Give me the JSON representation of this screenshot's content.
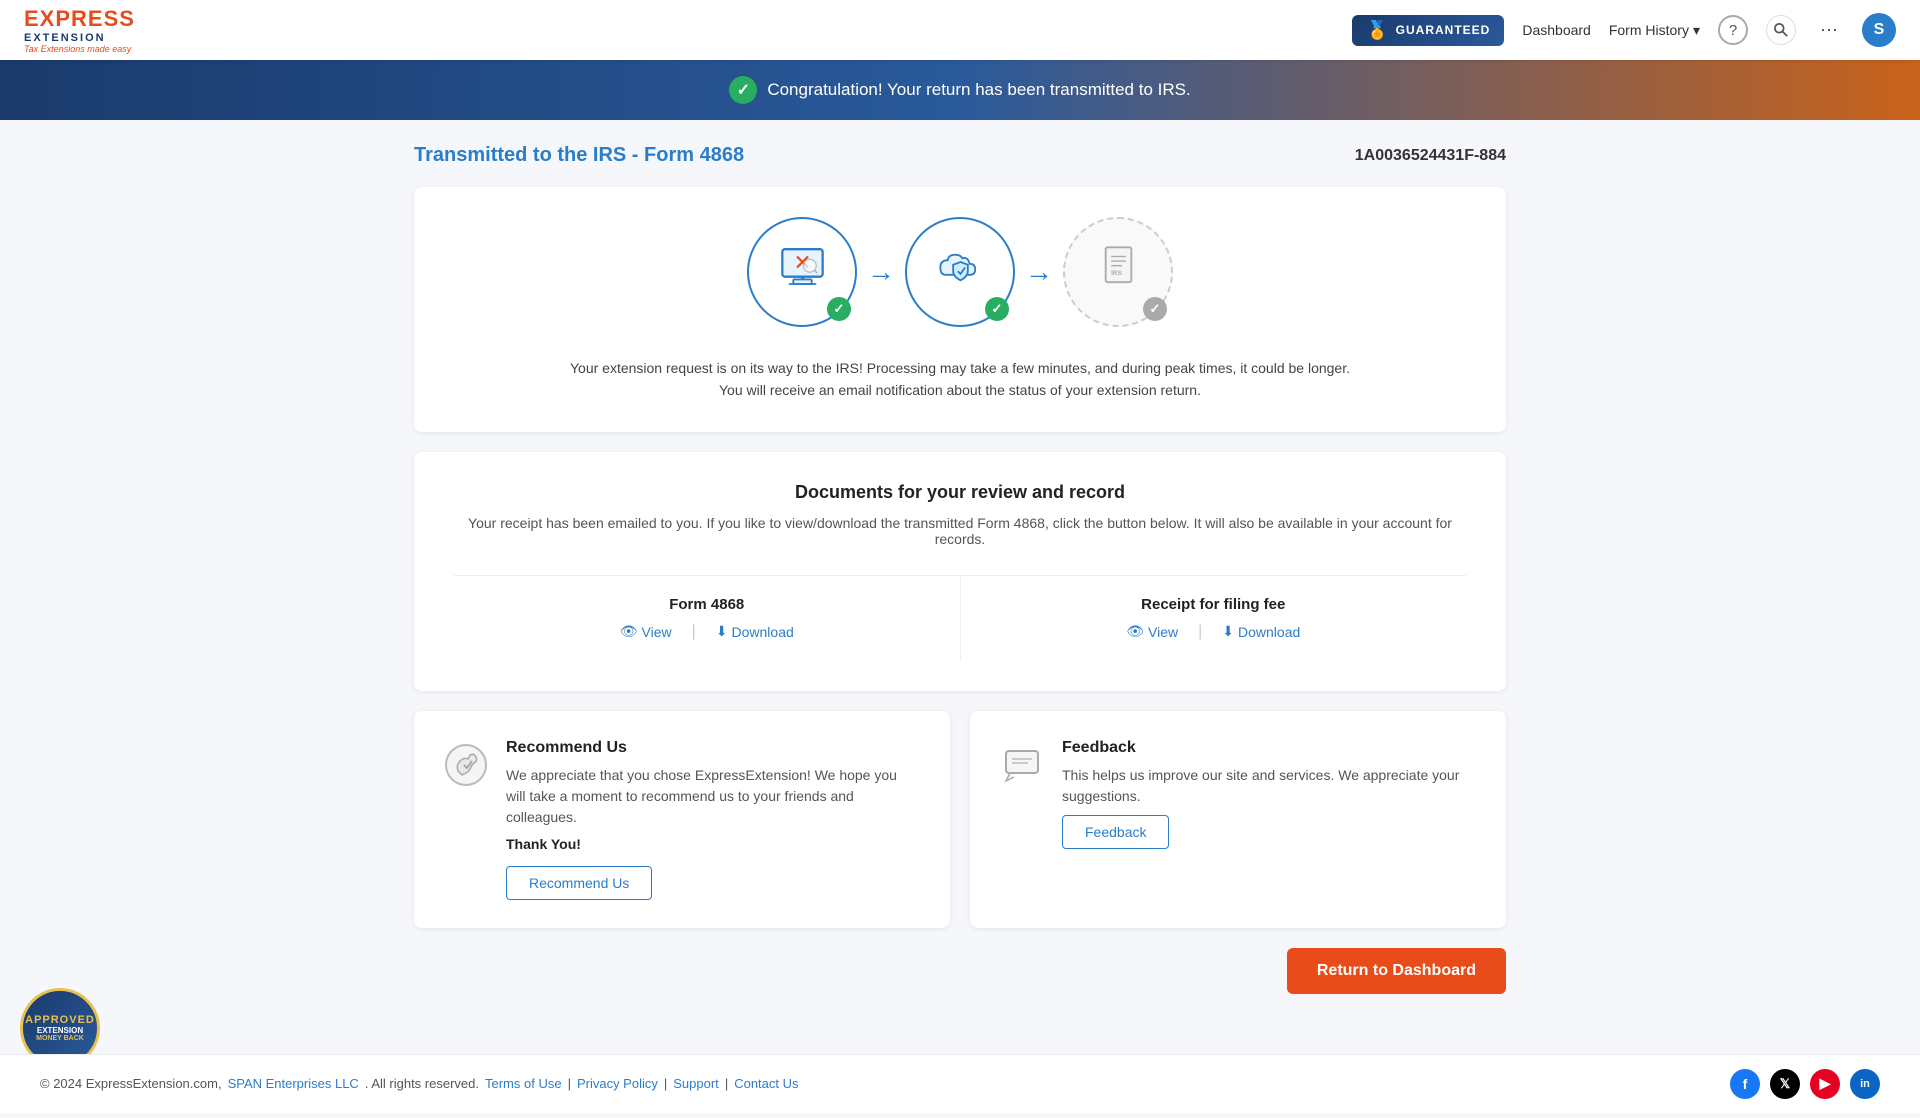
{
  "header": {
    "logo": {
      "express": "EXPRESS",
      "extension": "EXTENSION",
      "tagline": "Tax Extensions made easy"
    },
    "guaranteed_label": "GUARANTEED",
    "nav": {
      "dashboard": "Dashboard",
      "form_history": "Form History",
      "chevron": "▾"
    },
    "user_initial": "S"
  },
  "banner": {
    "message": "Congratulation! Your return has been transmitted to IRS."
  },
  "page_title": "Transmitted to the IRS - Form 4868",
  "form_id": "1A0036524431F-884",
  "status_card": {
    "description": "Your extension request is on its way to the IRS! Processing may take a few minutes, and during peak times, it could be longer. You will receive an email notification about the status of your extension return."
  },
  "documents_card": {
    "title": "Documents for your review and record",
    "subtitle": "Your receipt has been emailed to you. If you like to view/download the transmitted Form 4868, click the button below. It will also be available in your account for records.",
    "form4868": {
      "title": "Form 4868",
      "view_label": "View",
      "download_label": "Download"
    },
    "receipt": {
      "title": "Receipt for filing fee",
      "view_label": "View",
      "download_label": "Download"
    }
  },
  "recommend": {
    "title": "Recommend Us",
    "description": "We appreciate that you chose ExpressExtension! We hope you will take a moment to recommend us to your friends and colleagues.",
    "thank_you": "Thank You!",
    "button_label": "Recommend Us"
  },
  "feedback": {
    "title": "Feedback",
    "description": "This helps us improve our site and services. We appreciate your suggestions.",
    "button_label": "Feedback"
  },
  "return_btn": "Return to Dashboard",
  "footer": {
    "copyright": "© 2024 ExpressExtension.com,",
    "company": "SPAN Enterprises LLC",
    "rights": ". All rights reserved.",
    "terms": "Terms of Use",
    "privacy": "Privacy Policy",
    "support": "Support",
    "contact": "Contact Us"
  }
}
